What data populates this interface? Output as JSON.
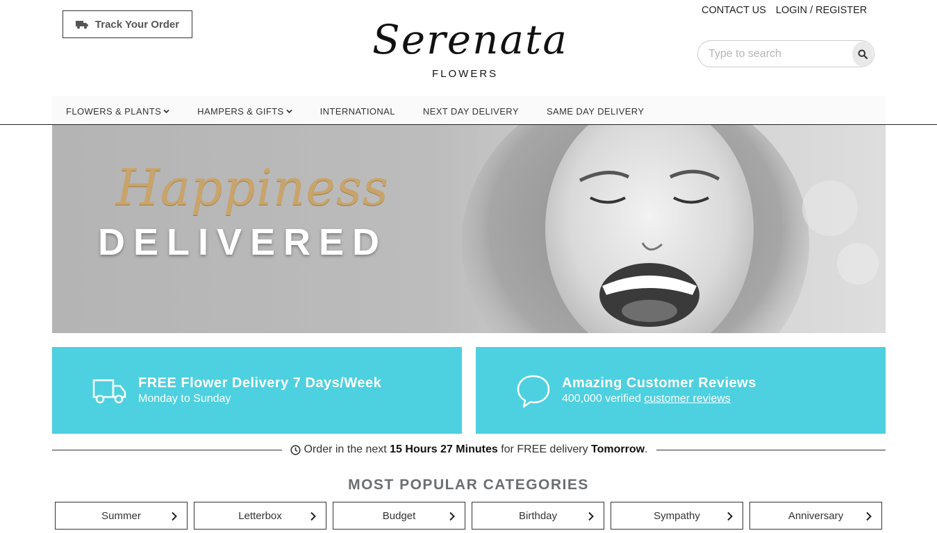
{
  "header": {
    "track_label": "Track Your Order",
    "logo_script": "Serenata",
    "logo_sub": "FLOWERS",
    "contact": "CONTACT US",
    "login": "LOGIN / REGISTER",
    "search_placeholder": "Type to search"
  },
  "nav": {
    "items": [
      {
        "label": "FLOWERS & PLANTS",
        "dropdown": true
      },
      {
        "label": "HAMPERS & GIFTS",
        "dropdown": true
      },
      {
        "label": "INTERNATIONAL",
        "dropdown": false
      },
      {
        "label": "NEXT DAY DELIVERY",
        "dropdown": false
      },
      {
        "label": "SAME DAY DELIVERY",
        "dropdown": false
      }
    ]
  },
  "hero": {
    "script": "Happiness",
    "headline": "DELIVERED"
  },
  "features": [
    {
      "title": "FREE Flower Delivery 7 Days/Week",
      "sub": "Monday to Sunday",
      "icon": "truck-icon"
    },
    {
      "title": "Amazing Customer Reviews",
      "sub_prefix": "400,000 verified ",
      "sub_link": "customer reviews",
      "icon": "speech-bubble-icon"
    }
  ],
  "countdown": {
    "prefix": "Order in the next ",
    "time": "15 Hours 27 Minutes",
    "middle": " for FREE delivery ",
    "day": "Tomorrow",
    "suffix": "."
  },
  "categories": {
    "heading": "MOST POPULAR CATEGORIES",
    "items": [
      "Summer",
      "Letterbox",
      "Budget",
      "Birthday",
      "Sympathy",
      "Anniversary"
    ]
  },
  "colors": {
    "accent": "#4dd0df",
    "gold": "#c9a46a",
    "heading_grey": "#6b6f72"
  }
}
